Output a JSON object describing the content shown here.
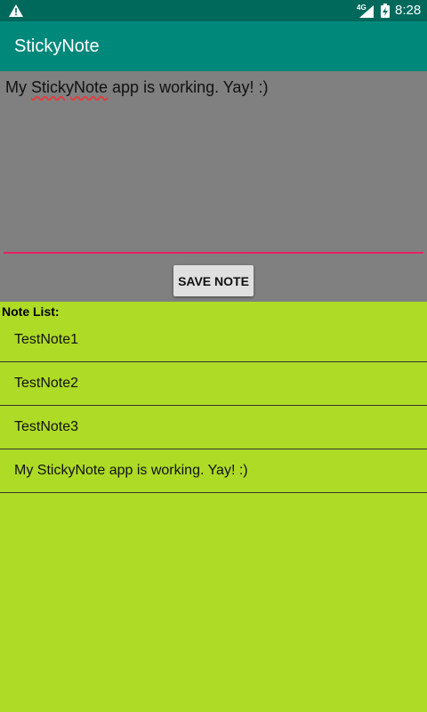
{
  "status_bar": {
    "network": "4G",
    "time": "8:28",
    "icons": [
      "warning-icon",
      "signal-icon",
      "battery-charging-icon"
    ]
  },
  "app_bar": {
    "title": "StickyNote"
  },
  "editor": {
    "text_before": "My ",
    "text_flagged": "StickyNote",
    "text_after": " app is working. Yay! :)",
    "accent_color": "#e91e63"
  },
  "save_button": {
    "label": "SAVE NOTE"
  },
  "note_list": {
    "header": "Note List:",
    "items": [
      "TestNote1",
      "TestNote2",
      "TestNote3",
      "My StickyNote app is working. Yay! :)"
    ]
  },
  "colors": {
    "status_bar": "#00695c",
    "app_bar": "#00897b",
    "editor_background": "#808080",
    "list_background": "#aedb26"
  }
}
